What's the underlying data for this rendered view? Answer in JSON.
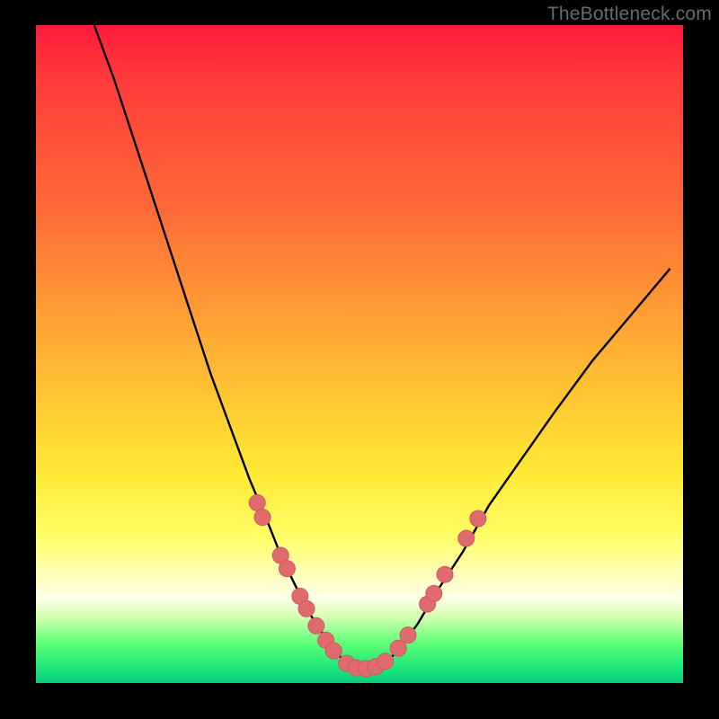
{
  "watermark": "TheBottleneck.com",
  "chart_data": {
    "type": "line",
    "title": "",
    "xlabel": "",
    "ylabel": "",
    "xlim": [
      0,
      100
    ],
    "ylim": [
      0,
      100
    ],
    "grid": false,
    "legend": false,
    "series": [
      {
        "name": "bottleneck-curve",
        "x": [
          9,
          12,
          15,
          18,
          21,
          24,
          27,
          30,
          33,
          36,
          38,
          40,
          42,
          44,
          46,
          48,
          50,
          52,
          54,
          56,
          59,
          62,
          66,
          70,
          75,
          80,
          86,
          92,
          98
        ],
        "y": [
          100,
          92,
          83,
          74,
          65,
          56,
          47,
          39,
          31,
          24,
          19,
          15,
          11,
          8,
          5,
          3,
          2,
          2,
          3,
          5,
          9,
          14,
          20,
          27,
          34,
          41,
          49,
          56,
          63
        ]
      }
    ],
    "markers": {
      "name": "highlight-dots",
      "points": [
        {
          "x": 34.2,
          "y": 27.4
        },
        {
          "x": 35.0,
          "y": 25.2
        },
        {
          "x": 37.8,
          "y": 19.4
        },
        {
          "x": 38.8,
          "y": 17.4
        },
        {
          "x": 40.8,
          "y": 13.2
        },
        {
          "x": 41.8,
          "y": 11.3
        },
        {
          "x": 43.3,
          "y": 8.7
        },
        {
          "x": 44.8,
          "y": 6.5
        },
        {
          "x": 46.0,
          "y": 4.9
        },
        {
          "x": 48.0,
          "y": 3.0
        },
        {
          "x": 49.5,
          "y": 2.3
        },
        {
          "x": 51.0,
          "y": 2.2
        },
        {
          "x": 52.5,
          "y": 2.5
        },
        {
          "x": 54.0,
          "y": 3.3
        },
        {
          "x": 56.0,
          "y": 5.3
        },
        {
          "x": 57.5,
          "y": 7.3
        },
        {
          "x": 60.5,
          "y": 12.0
        },
        {
          "x": 61.5,
          "y": 13.6
        },
        {
          "x": 63.2,
          "y": 16.5
        },
        {
          "x": 66.5,
          "y": 22.0
        },
        {
          "x": 68.3,
          "y": 25.0
        }
      ]
    },
    "gradient_stops": [
      {
        "pos": 0,
        "color": "#ff1a3a"
      },
      {
        "pos": 28,
        "color": "#ff6a37"
      },
      {
        "pos": 50,
        "color": "#ffb233"
      },
      {
        "pos": 78,
        "color": "#ffff6a"
      },
      {
        "pos": 100,
        "color": "#0acb77"
      }
    ]
  }
}
